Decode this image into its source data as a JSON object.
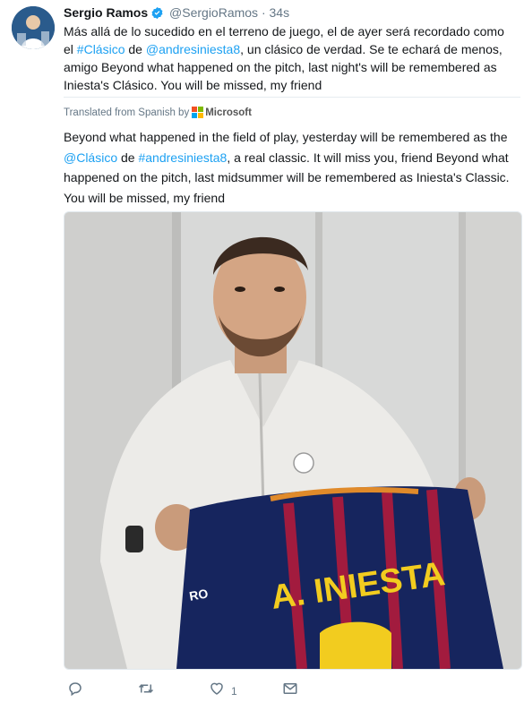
{
  "tweet": {
    "author_name": "Sergio Ramos",
    "handle": "@SergioRamos",
    "separator": "·",
    "time": "34s",
    "text": {
      "p1": "Más allá de lo sucedido en el terreno de juego, el de ayer será recordado como el ",
      "hashtag": "#Clásico",
      "p2": " de ",
      "mention": "@andresiniesta8",
      "p3": ", un clásico de verdad. Se te echará de menos, amigo Beyond what happened on the pitch, last night's will be remembered as Iniesta's Clásico. You will be missed, my friend"
    },
    "translated_from": "Translated from Spanish by",
    "translator": "Microsoft",
    "translation": {
      "p1": "Beyond what happened in the field of play, yesterday will be remembered as the ",
      "mention": "@Clásico",
      "p2": " de ",
      "hashtag": "#andresiniesta8",
      "p3": ", a real classic. It will miss you, friend Beyond what happened on the pitch, last midsummer will be remembered as Iniesta's Classic. You will be missed, my friend"
    },
    "media": {
      "jersey_name": "A. INIESTA"
    },
    "actions": {
      "like_count": "1"
    }
  },
  "colors": {
    "link": "#1da1f2",
    "muted": "#657786",
    "verified": "#1da1f2"
  },
  "icons": [
    "verified-badge-icon",
    "microsoft-logo-icon",
    "reply-icon",
    "retweet-icon",
    "like-icon",
    "direct-message-icon"
  ]
}
